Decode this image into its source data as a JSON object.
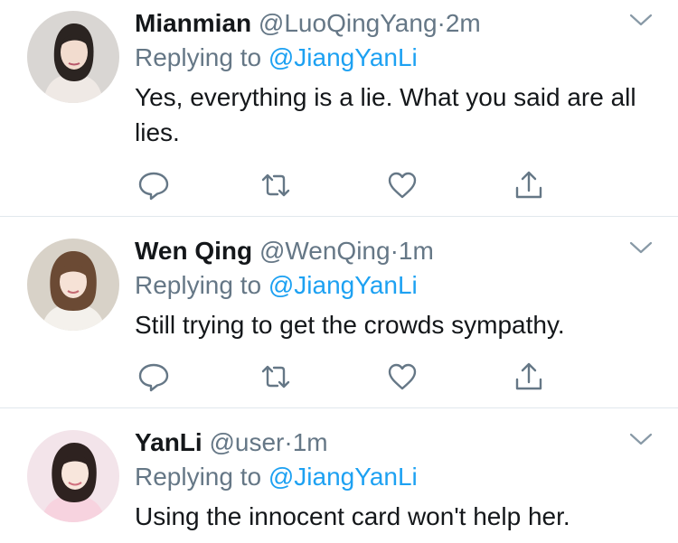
{
  "tweets": [
    {
      "name": "Mianmian",
      "handle": "@LuoQingYang",
      "dot": "·",
      "time": "2m",
      "reply_prefix": "Replying to",
      "reply_mention": "@JiangYanLi",
      "text": "Yes, everything is a lie. What you said are all lies."
    },
    {
      "name": "Wen Qing",
      "handle": "@WenQing",
      "dot": "·",
      "time": "1m",
      "reply_prefix": "Replying to",
      "reply_mention": "@JiangYanLi",
      "text": "Still trying to get the crowds sympathy."
    },
    {
      "name": "YanLi",
      "handle": "@user",
      "dot": "·",
      "time": "1m",
      "reply_prefix": "Replying to",
      "reply_mention": "@JiangYanLi",
      "text": "Using the innocent card won't help her."
    }
  ],
  "icons": {
    "reply": "reply-icon",
    "retweet": "retweet-icon",
    "like": "heart-icon",
    "share": "share-icon",
    "menu": "chevron-down-icon"
  },
  "colors": {
    "text": "#14171a",
    "secondary": "#657786",
    "link": "#1da1f2",
    "divider": "#e1e8ed"
  }
}
